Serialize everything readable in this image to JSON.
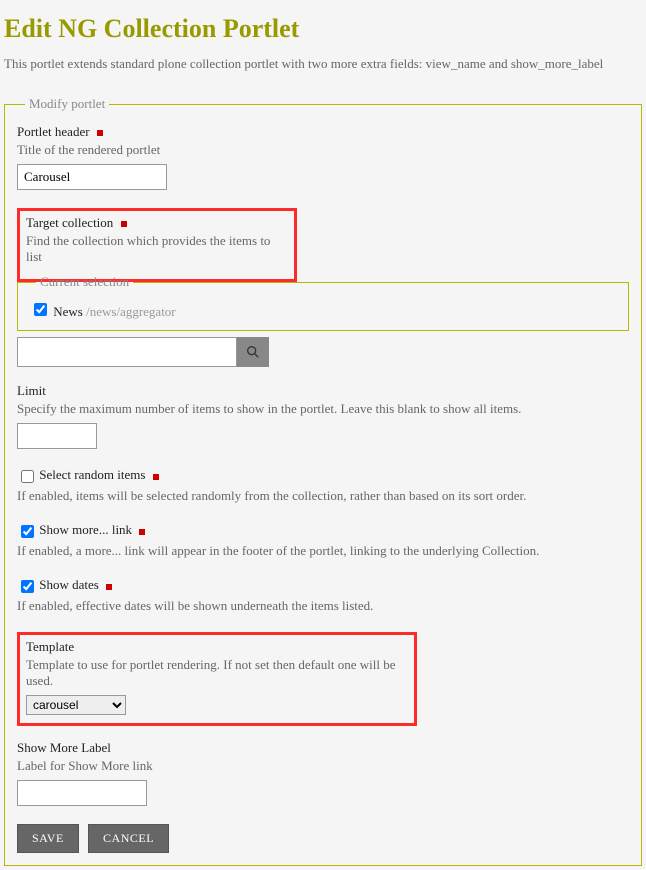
{
  "page": {
    "title": "Edit NG Collection Portlet",
    "intro": "This portlet extends standard plone collection portlet with two more extra fields: view_name and show_more_label"
  },
  "fieldset_legend": "Modify portlet",
  "portlet_header": {
    "label": "Portlet header",
    "help": "Title of the rendered portlet",
    "value": "Carousel"
  },
  "target": {
    "label": "Target collection",
    "help": "Find the collection which provides the items to list",
    "selection_legend": "Current selection",
    "item_name": "News",
    "item_path": "/news/aggregator"
  },
  "search": {
    "placeholder": ""
  },
  "limit": {
    "label": "Limit",
    "help": "Specify the maximum number of items to show in the portlet. Leave this blank to show all items.",
    "value": ""
  },
  "random": {
    "label": "Select random items",
    "help": "If enabled, items will be selected randomly from the collection, rather than based on its sort order."
  },
  "show_more": {
    "label": "Show more... link",
    "help": "If enabled, a more... link will appear in the footer of the portlet, linking to the underlying Collection."
  },
  "show_dates": {
    "label": "Show dates",
    "help": "If enabled, effective dates will be shown underneath the items listed."
  },
  "template": {
    "label": "Template",
    "help": "Template to use for portlet rendering. If not set then default one will be used.",
    "value": "carousel"
  },
  "show_more_label": {
    "label": "Show More Label",
    "help": "Label for Show More link",
    "value": ""
  },
  "buttons": {
    "save": "SAVE",
    "cancel": "CANCEL"
  }
}
